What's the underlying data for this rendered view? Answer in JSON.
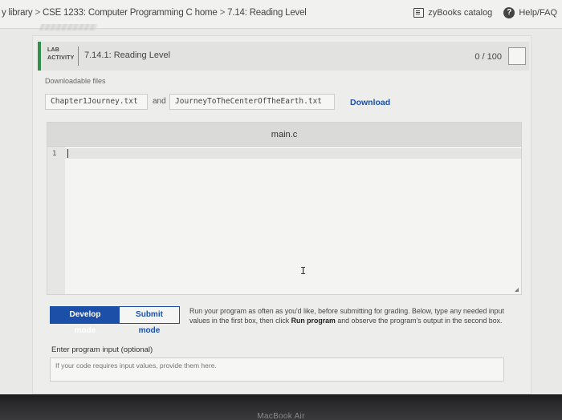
{
  "breadcrumb": {
    "items": [
      "y library",
      "CSE 1233: Computer Programming C home",
      "7.14: Reading Level"
    ],
    "separator": ">"
  },
  "top_right": {
    "catalog_label": "zyBooks catalog",
    "help_label": "Help/FAQ",
    "help_glyph": "?"
  },
  "lab": {
    "tag_line1": "LAB",
    "tag_line2": "ACTIVITY",
    "title": "7.14.1: Reading Level",
    "score": "0 / 100",
    "accent_color": "#2f8f4b"
  },
  "downloads": {
    "label": "Downloadable files",
    "file1": "Chapter1Journey.txt",
    "conjunction": "and",
    "file2": "JourneyToTheCenterOfTheEarth.txt",
    "download_label": "Download"
  },
  "editor": {
    "filename": "main.c",
    "line_number": "1",
    "pointer_glyph": "I"
  },
  "modes": {
    "develop_label": "Develop mode",
    "submit_label": "Submit mode",
    "active": "develop",
    "accent_color": "#1c4fa8"
  },
  "instructions": {
    "part1": "Run your program as often as you'd like, before submitting for grading. Below, type any needed input values in the first box, then click ",
    "run_bold": "Run program",
    "part2": " and observe the program's output in the second box."
  },
  "program_input": {
    "label": "Enter program input (optional)",
    "placeholder": "If your code requires input values, provide them here."
  },
  "device": {
    "label": "MacBook Air"
  }
}
